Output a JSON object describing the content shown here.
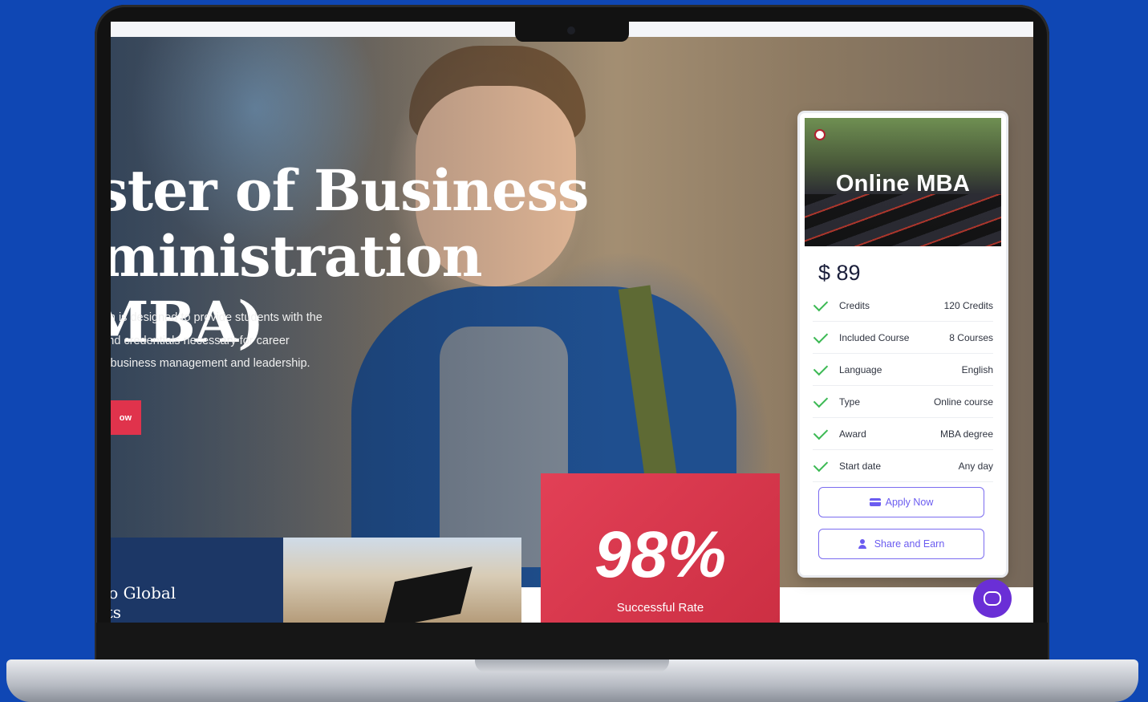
{
  "hero": {
    "title_line1": "aster of Business",
    "title_line2": "dministration (MBA)",
    "description_line1": "rogram is designed to provide students with the",
    "description_line2": "kills and credentials necessary for career",
    "description_line3": "ent in business management and leadership.",
    "cta_label": "ow"
  },
  "lower_strip": {
    "global_line1": "n to Global",
    "global_line2": "ents",
    "stat_value": "98%",
    "stat_label": "Successful Rate"
  },
  "course_card": {
    "banner_title": "Online MBA",
    "price": "$ 89",
    "details": [
      {
        "label": "Credits",
        "value": "120 Credits"
      },
      {
        "label": "Included Course",
        "value": "8 Courses"
      },
      {
        "label": "Language",
        "value": "English"
      },
      {
        "label": "Type",
        "value": "Online course"
      },
      {
        "label": "Award",
        "value": "MBA degree"
      },
      {
        "label": "Start date",
        "value": "Any day"
      }
    ],
    "apply_label": "Apply Now",
    "share_label": "Share and Earn"
  },
  "icons": {
    "check": "check-icon",
    "apply": "credit-card-icon",
    "share": "user-plus-icon",
    "chat": "chat-bubble-icon"
  },
  "colors": {
    "page_background": "#0f47b4",
    "accent_red": "#e0334c",
    "navy": "#1c3766",
    "button_purple": "#6b5cf0",
    "check_green": "#3cb954",
    "chat_fab": "#6a2fd6"
  }
}
